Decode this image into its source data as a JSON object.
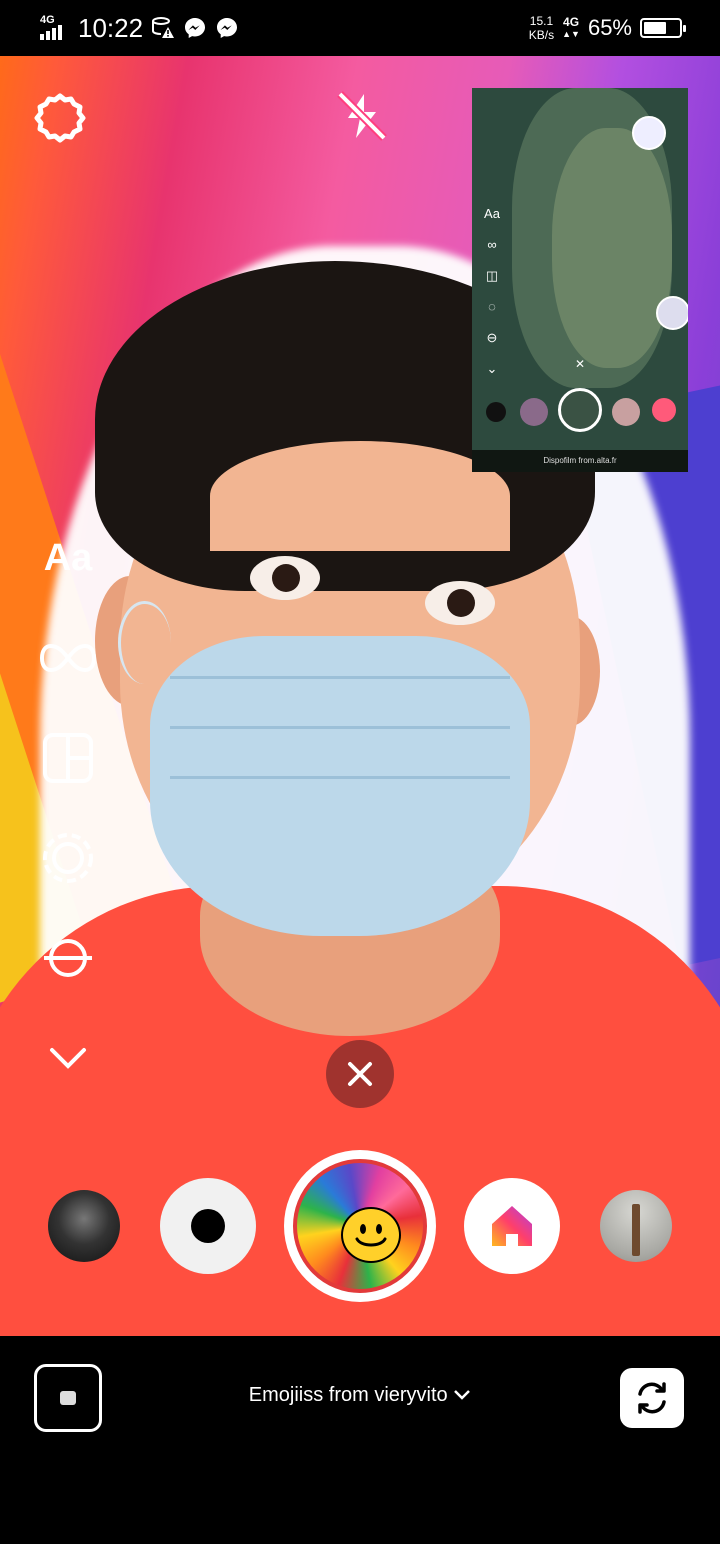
{
  "status_bar": {
    "network_left": "4G",
    "time": "10:22",
    "speed_value": "15.1",
    "speed_unit": "KB/s",
    "network_right": "4G",
    "battery_percent": "65%",
    "battery_level": 0.65
  },
  "camera": {
    "settings_icon": "settings-icon",
    "flash_icon": "flash-off-icon",
    "tools": [
      {
        "name": "text",
        "label": "Aa"
      },
      {
        "name": "boomerang",
        "icon": "infinity-icon"
      },
      {
        "name": "layout",
        "icon": "layout-icon"
      },
      {
        "name": "multi-capture",
        "icon": "dashed-circle-icon"
      },
      {
        "name": "level",
        "icon": "level-icon"
      },
      {
        "name": "more",
        "icon": "chevron-down-icon"
      }
    ]
  },
  "pip": {
    "sidebar_text": "Aa",
    "bottom_text": "Dispofilm from.alta.fr"
  },
  "effects": {
    "selected_name": "Emojiiss from vieryvito",
    "items": [
      "dark-scenery-effect",
      "dot-effect",
      "rainbow-smiley-effect",
      "home-effect",
      "tower-effect"
    ]
  },
  "colors": {
    "record_ring": "#ffffff",
    "accent_red": "#e23a3a",
    "shirt": "#ff4f3f"
  }
}
